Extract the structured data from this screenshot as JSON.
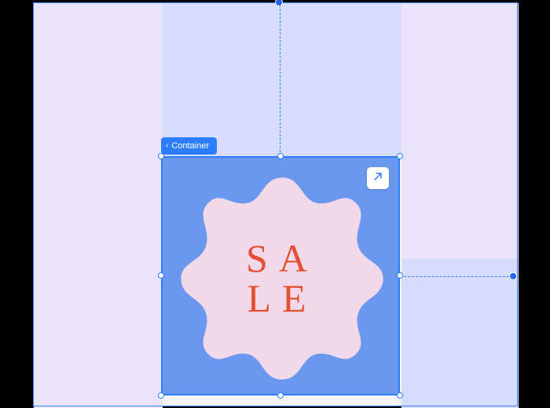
{
  "breadcrumb": {
    "label": "Container"
  },
  "selection": {
    "expand_tooltip": "Expand",
    "graphic_text_line1": "SA",
    "graphic_text_line2": "LE"
  },
  "colors": {
    "selection_stroke": "#2c7eff",
    "container_fill": "#6a98ee",
    "burst_fill": "#f1d9e9",
    "text_fill": "#e4502f",
    "bg_lavender": "#e9e4fa",
    "bg_lightblue": "#d6dcfb"
  }
}
